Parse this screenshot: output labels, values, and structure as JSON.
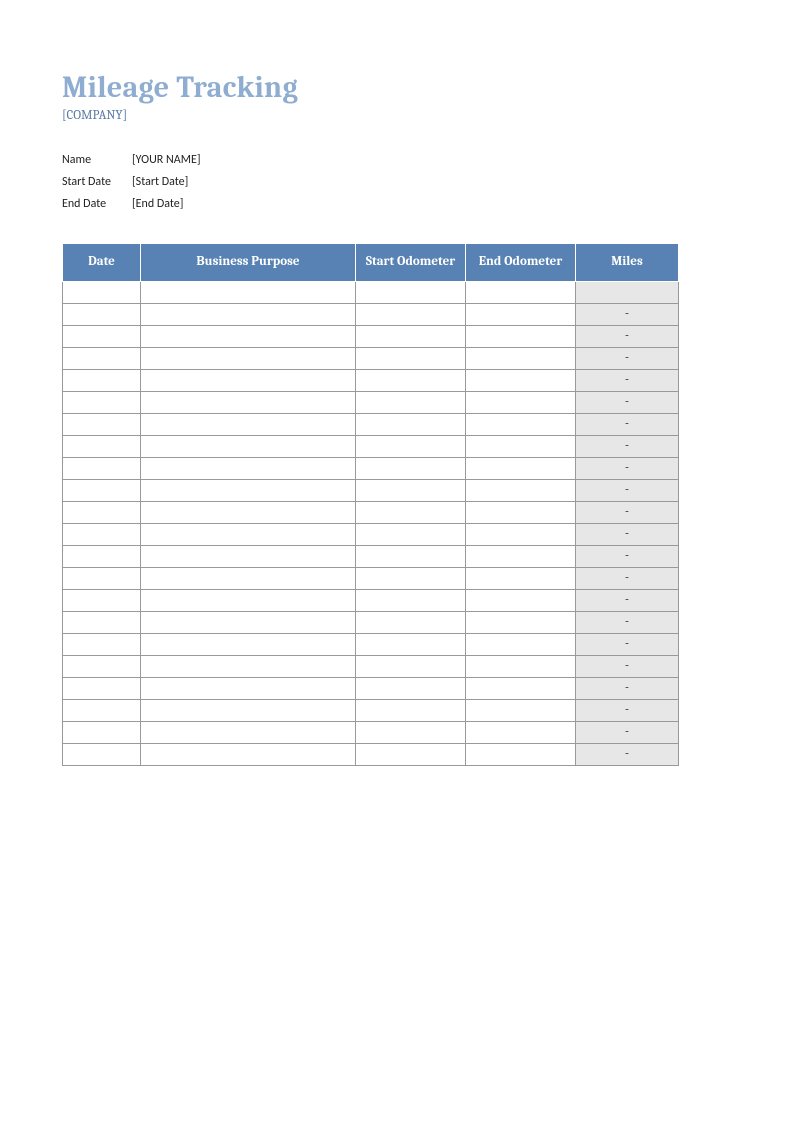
{
  "header": {
    "title": "Mileage Tracking",
    "company": "[COMPANY]"
  },
  "info": {
    "name_label": "Name",
    "name_value": "[YOUR NAME]",
    "start_label": "Start Date",
    "start_value": "[Start Date]",
    "end_label": "End Date",
    "end_value": "[End Date]"
  },
  "table": {
    "columns": [
      "Date",
      "Business Purpose",
      "Start Odometer",
      "End Odometer",
      "Miles"
    ],
    "rows": [
      {
        "date": "",
        "purpose": "",
        "start": "",
        "end": "",
        "miles": ""
      },
      {
        "date": "",
        "purpose": "",
        "start": "",
        "end": "",
        "miles": "-"
      },
      {
        "date": "",
        "purpose": "",
        "start": "",
        "end": "",
        "miles": "-"
      },
      {
        "date": "",
        "purpose": "",
        "start": "",
        "end": "",
        "miles": "-"
      },
      {
        "date": "",
        "purpose": "",
        "start": "",
        "end": "",
        "miles": "-"
      },
      {
        "date": "",
        "purpose": "",
        "start": "",
        "end": "",
        "miles": "-"
      },
      {
        "date": "",
        "purpose": "",
        "start": "",
        "end": "",
        "miles": "-"
      },
      {
        "date": "",
        "purpose": "",
        "start": "",
        "end": "",
        "miles": "-"
      },
      {
        "date": "",
        "purpose": "",
        "start": "",
        "end": "",
        "miles": "-"
      },
      {
        "date": "",
        "purpose": "",
        "start": "",
        "end": "",
        "miles": "-"
      },
      {
        "date": "",
        "purpose": "",
        "start": "",
        "end": "",
        "miles": "-"
      },
      {
        "date": "",
        "purpose": "",
        "start": "",
        "end": "",
        "miles": "-"
      },
      {
        "date": "",
        "purpose": "",
        "start": "",
        "end": "",
        "miles": "-"
      },
      {
        "date": "",
        "purpose": "",
        "start": "",
        "end": "",
        "miles": "-"
      },
      {
        "date": "",
        "purpose": "",
        "start": "",
        "end": "",
        "miles": "-"
      },
      {
        "date": "",
        "purpose": "",
        "start": "",
        "end": "",
        "miles": "-"
      },
      {
        "date": "",
        "purpose": "",
        "start": "",
        "end": "",
        "miles": "-"
      },
      {
        "date": "",
        "purpose": "",
        "start": "",
        "end": "",
        "miles": "-"
      },
      {
        "date": "",
        "purpose": "",
        "start": "",
        "end": "",
        "miles": "-"
      },
      {
        "date": "",
        "purpose": "",
        "start": "",
        "end": "",
        "miles": "-"
      },
      {
        "date": "",
        "purpose": "",
        "start": "",
        "end": "",
        "miles": "-"
      },
      {
        "date": "",
        "purpose": "",
        "start": "",
        "end": "",
        "miles": "-"
      }
    ]
  }
}
